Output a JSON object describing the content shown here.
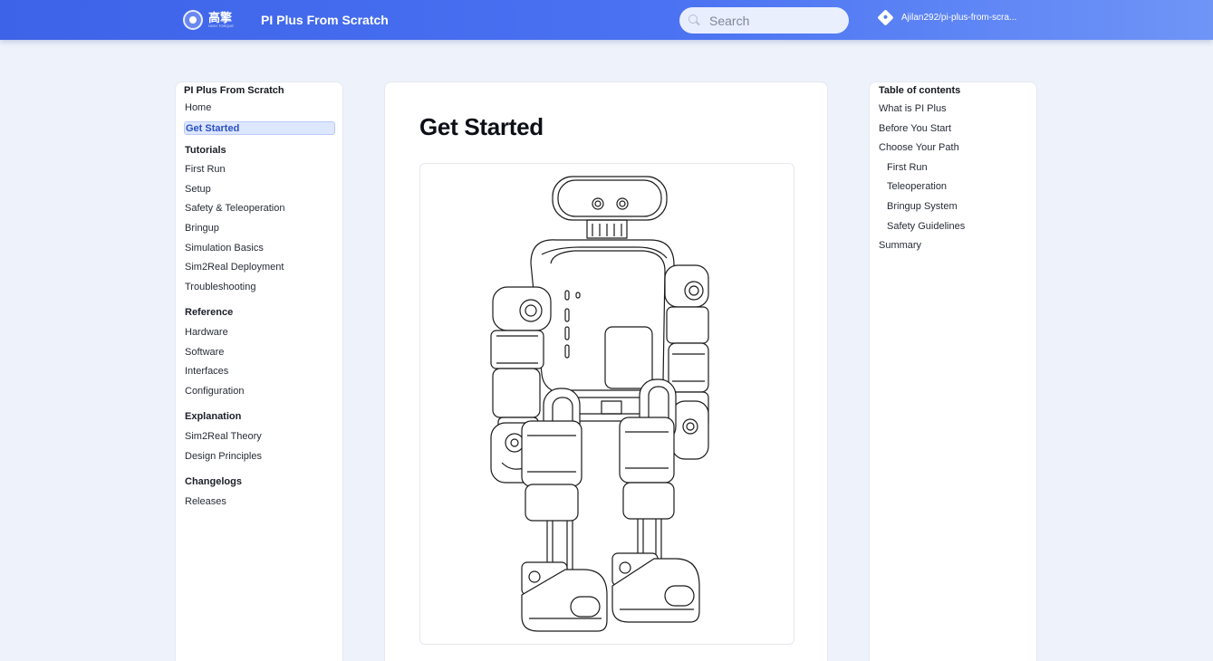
{
  "header": {
    "logo_text": "高擎",
    "logo_sub": "HIGH TORQUE",
    "site_title": "PI Plus From Scratch",
    "search_placeholder": "Search",
    "repo_label": "Ajilan292/pi-plus-from-scra..."
  },
  "sidebar": {
    "title": "PI Plus From Scratch",
    "top_items": [
      "Home",
      "Get Started"
    ],
    "active": "Get Started",
    "sections": [
      {
        "heading": "Tutorials",
        "items": [
          "First Run",
          "Setup",
          "Safety & Teleoperation",
          "Bringup",
          "Simulation Basics",
          "Sim2Real Deployment",
          "Troubleshooting"
        ]
      },
      {
        "heading": "Reference",
        "items": [
          "Hardware",
          "Software",
          "Interfaces",
          "Configuration"
        ]
      },
      {
        "heading": "Explanation",
        "items": [
          "Sim2Real Theory",
          "Design Principles"
        ]
      },
      {
        "heading": "Changelogs",
        "items": [
          "Releases"
        ]
      }
    ]
  },
  "main": {
    "title": "Get Started",
    "figure_icon": "humanoid-robot-line-drawing"
  },
  "toc": {
    "title": "Table of contents",
    "items": [
      {
        "label": "What is PI Plus",
        "sub": false
      },
      {
        "label": "Before You Start",
        "sub": false
      },
      {
        "label": "Choose Your Path",
        "sub": false
      },
      {
        "label": "First Run",
        "sub": true
      },
      {
        "label": "Teleoperation",
        "sub": true
      },
      {
        "label": "Bringup System",
        "sub": true
      },
      {
        "label": "Safety Guidelines",
        "sub": true
      },
      {
        "label": "Summary",
        "sub": false
      }
    ]
  },
  "colors": {
    "header_start": "#3d63e8",
    "header_end": "#6f95f7",
    "active_bg": "#dde7fd",
    "active_text": "#2a50c9",
    "page_bg": "#eef2fa"
  }
}
